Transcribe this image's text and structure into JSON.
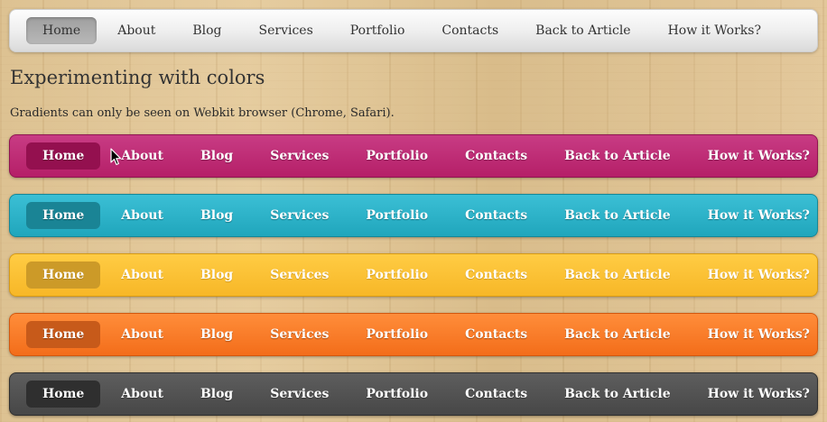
{
  "menu_labels": {
    "home": "Home",
    "about": "About",
    "blog": "Blog",
    "services": "Services",
    "portfolio": "Portfolio",
    "contacts": "Contacts",
    "back_to_article": "Back to Article",
    "how_it_works": "How it Works?"
  },
  "content": {
    "heading": "Experimenting with colors",
    "note": "Gradients can only be seen on Webkit browser (Chrome, Safari)."
  },
  "menus": [
    {
      "theme": "gray",
      "base_color": "#e8e8e8",
      "active_item": "Home"
    },
    {
      "theme": "pink",
      "base_color": "#b51f68",
      "active_item": "Home"
    },
    {
      "theme": "teal",
      "base_color": "#20a6bc",
      "active_item": "Home"
    },
    {
      "theme": "yellow",
      "base_color": "#f7b727",
      "active_item": "Home"
    },
    {
      "theme": "orange",
      "base_color": "#f36d1a",
      "active_item": "Home"
    },
    {
      "theme": "dark",
      "base_color": "#474747",
      "active_item": "Home"
    }
  ],
  "cursor": {
    "icon": "arrow-cursor-icon"
  }
}
